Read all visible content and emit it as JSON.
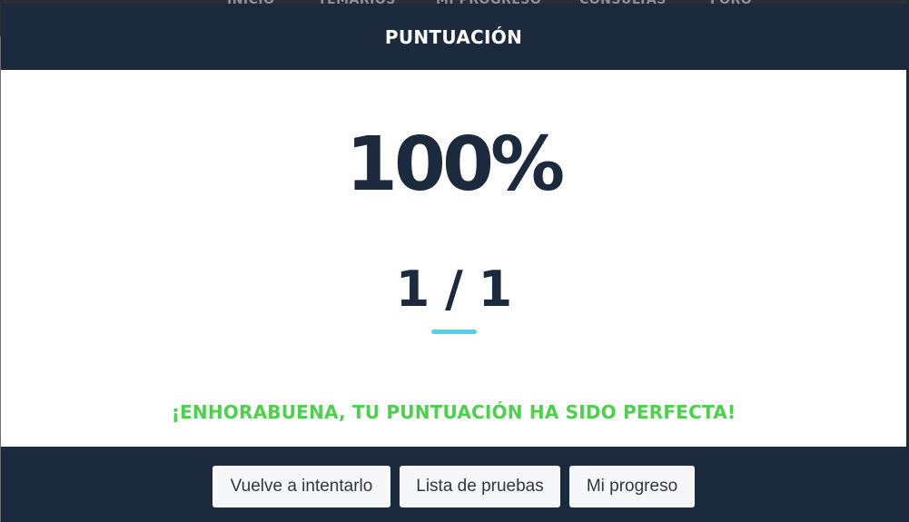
{
  "background_nav": {
    "items": [
      "INICIO",
      "TEMARIOS",
      "MI PROGRESO",
      "CONSULTAS",
      "FORO"
    ]
  },
  "modal": {
    "title": "PUNTUACIÓN",
    "percent": "100%",
    "fraction": "1 / 1",
    "message": "¡ENHORABUENA, TU PUNTUACIÓN HA SIDO PERFECTA!"
  },
  "footer": {
    "buttons": [
      {
        "label": "Vuelve a intentarlo"
      },
      {
        "label": "Lista de pruebas"
      },
      {
        "label": "Mi progreso"
      }
    ]
  },
  "colors": {
    "header_bg": "#1b2a3c",
    "accent": "#4fd3f0",
    "success": "#4cd14a",
    "button_bg": "#f6f7f9"
  }
}
